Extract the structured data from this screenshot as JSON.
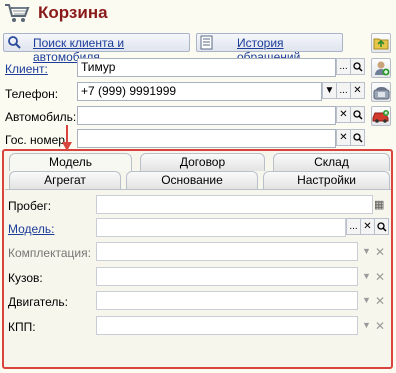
{
  "window": {
    "title": "Корзина"
  },
  "toolbar": {
    "search_label": "Поиск клиента и автомобиля",
    "history_label": "История обращений"
  },
  "form": {
    "client": {
      "label": "Клиент:",
      "value": "Тимур"
    },
    "phone": {
      "label": "Телефон:",
      "value": "+7 (999) 9991999"
    },
    "car": {
      "label": "Автомобиль:",
      "value": ""
    },
    "plate": {
      "label": "Гос. номер",
      "value": ""
    }
  },
  "tabs": {
    "row1": [
      "Модель",
      "Договор",
      "Склад"
    ],
    "row2": [
      "Агрегат",
      "Основание",
      "Настройки"
    ],
    "active": "Модель"
  },
  "model_tab": {
    "mileage": {
      "label": "Пробег:",
      "value": ""
    },
    "model": {
      "label": "Модель:",
      "value": ""
    },
    "equipment": {
      "label": "Комплектация:",
      "value": ""
    },
    "body": {
      "label": "Кузов:",
      "value": ""
    },
    "engine": {
      "label": "Двигатель:",
      "value": ""
    },
    "gearbox": {
      "label": "КПП:",
      "value": ""
    }
  },
  "glyphs": {
    "ellipsis": "...",
    "clear": "✕",
    "search": "⚲",
    "dropdown": "▼",
    "calc": "▦"
  },
  "colors": {
    "title": "#8a1a1a",
    "link": "#1c3d9a",
    "highlight": "#d9453e"
  }
}
